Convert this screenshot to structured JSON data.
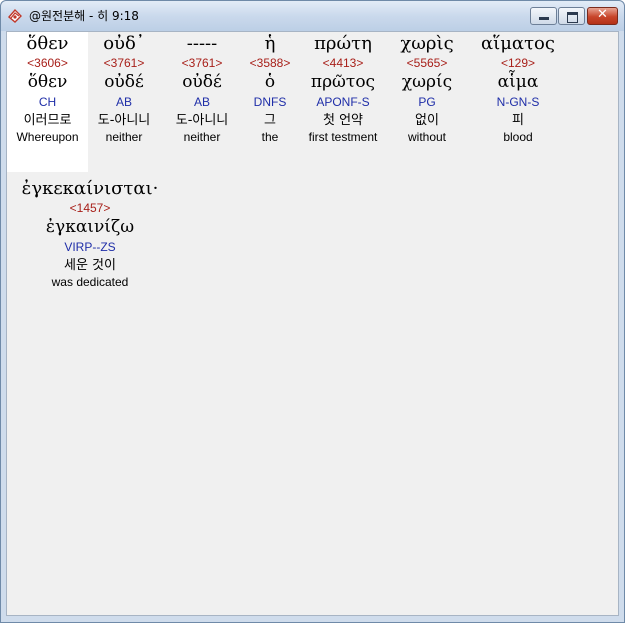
{
  "window": {
    "title": "@원전분해 - 히 9:18",
    "minimize_symbol": "",
    "maximize_symbol": "",
    "close_symbol": "✕",
    "accent": "#cad9ec",
    "strong_color": "#a8201a",
    "parse_color": "#1f2ea8"
  },
  "words": [
    {
      "greek": "ὅθεν",
      "strong": "<3606>",
      "lemma": "ὅθεν",
      "parse": "CH",
      "korean": "이러므로",
      "english": "Whereupon"
    },
    {
      "greek": "οὐδ᾽",
      "strong": "<3761>",
      "lemma": "οὐδέ",
      "parse": "AB",
      "korean": "도-아니니",
      "english": "neither"
    },
    {
      "greek": "-----",
      "strong": "<3761>",
      "lemma": "οὐδέ",
      "parse": "AB",
      "korean": "도-아니니",
      "english": "neither"
    },
    {
      "greek": "ἡ",
      "strong": "<3588>",
      "lemma": "ὁ",
      "parse": "DNFS",
      "korean": "그",
      "english": "the"
    },
    {
      "greek": "πρώτη",
      "strong": "<4413>",
      "lemma": "πρῶτος",
      "parse": "APONF-S",
      "korean": "첫 언약",
      "english": "first testment"
    },
    {
      "greek": "χωρὶς",
      "strong": "<5565>",
      "lemma": "χωρίς",
      "parse": "PG",
      "korean": "없이",
      "english": "without"
    },
    {
      "greek": "αἵματος",
      "strong": "<129>",
      "lemma": "αἷμα",
      "parse": "N-GN-S",
      "korean": "피",
      "english": "blood"
    },
    {
      "greek": "ἐγκεκαίνισται·",
      "strong": "<1457>",
      "lemma": "ἐγκαινίζω",
      "parse": "VIRP--ZS",
      "korean": "세운 것이",
      "english": "was dedicated"
    }
  ]
}
